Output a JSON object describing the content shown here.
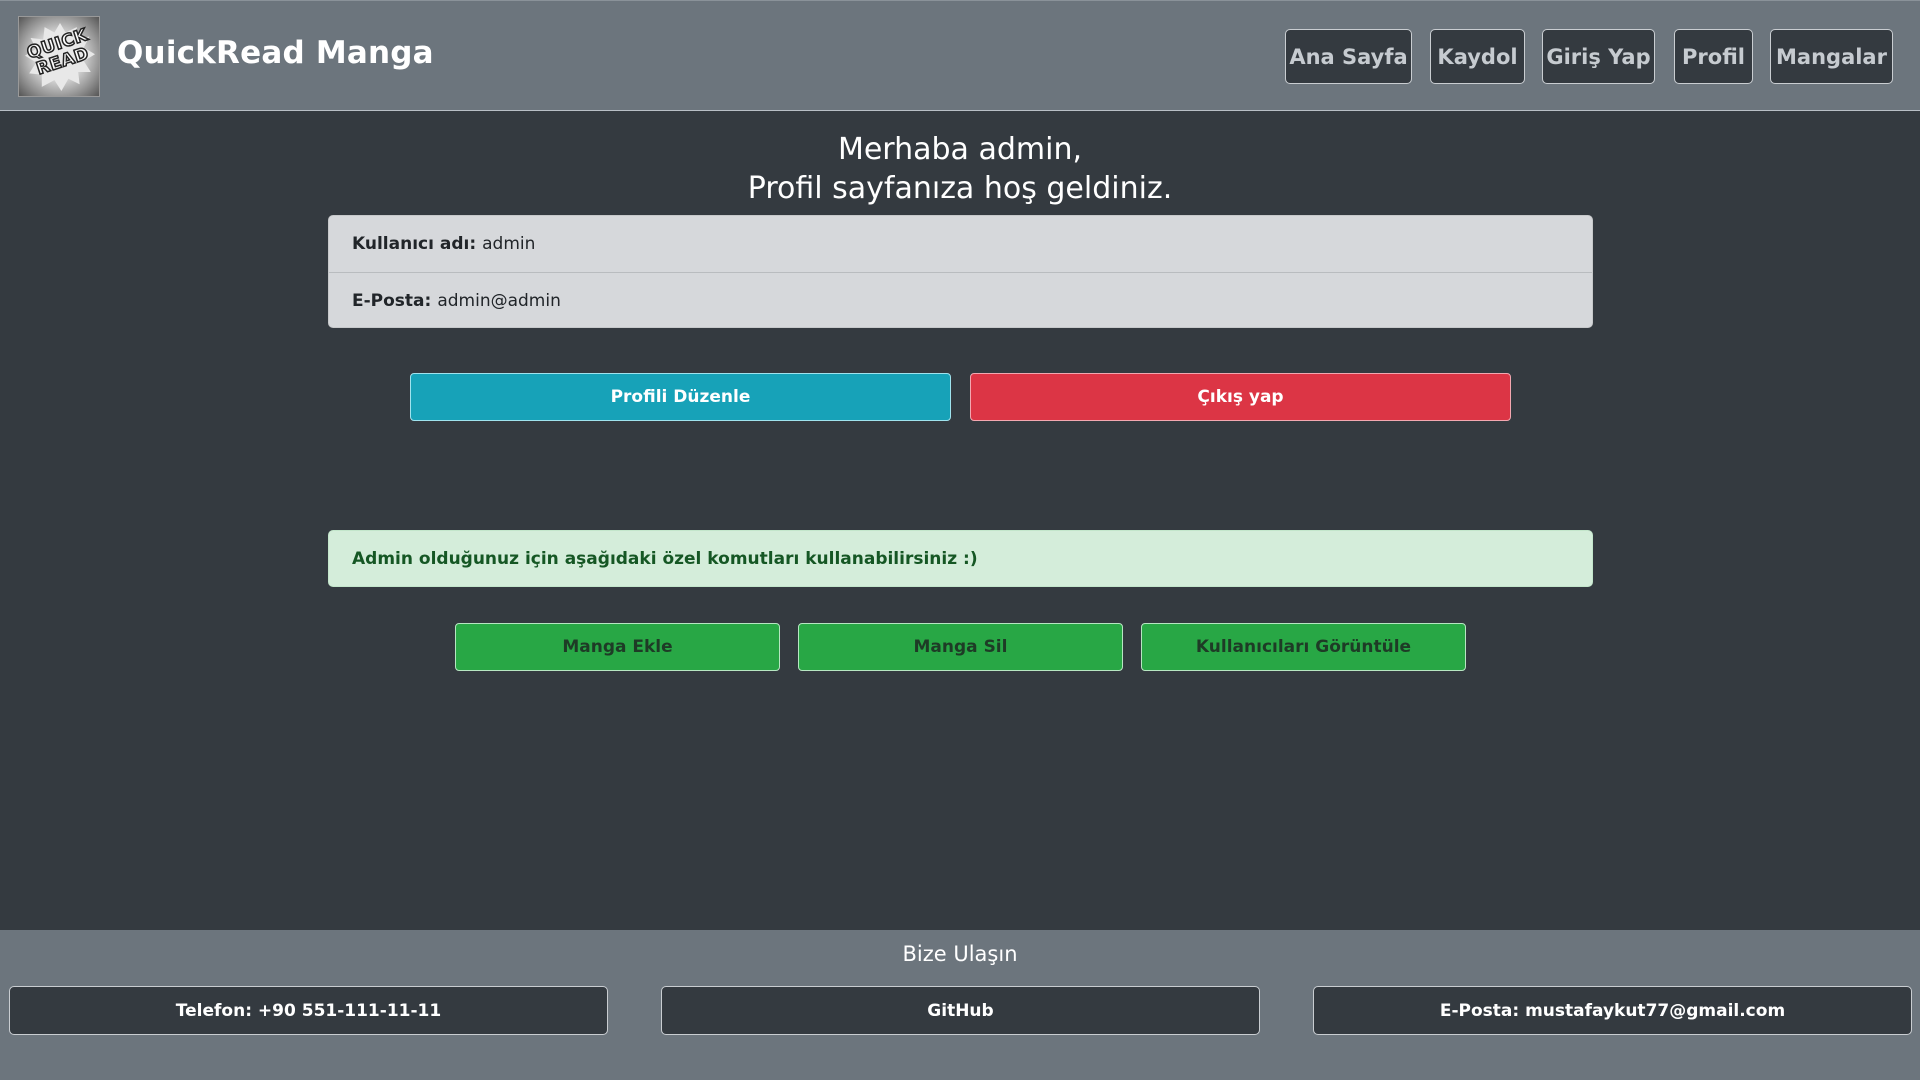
{
  "header": {
    "logo_text_line1": "QUICK",
    "logo_text_line2": "READ",
    "brand": "QuickRead Manga",
    "nav": [
      "Ana Sayfa",
      "Kaydol",
      "Giriş Yap",
      "Profil",
      "Mangalar"
    ]
  },
  "main": {
    "welcome_line1": "Merhaba admin,",
    "welcome_line2": "Profil sayfanıza hoş geldiniz.",
    "username_label": "Kullanıcı adı:",
    "username_value": "admin",
    "email_label": "E-Posta:",
    "email_value": "admin@admin",
    "edit_profile_label": "Profili Düzenle",
    "logout_label": "Çıkış yap",
    "admin_alert": "Admin olduğunuz için aşağıdaki özel komutları kullanabilirsiniz :)",
    "admin_actions": [
      "Manga Ekle",
      "Manga Sil",
      "Kullanıcıları Görüntüle"
    ]
  },
  "footer": {
    "title": "Bize Ulaşın",
    "phone": "Telefon: +90 551-111-11-11",
    "github": "GitHub",
    "email": "E-Posta: mustafaykut77@gmail.com"
  },
  "colors": {
    "header_bg": "#6c757d",
    "body_bg": "#343a40",
    "info": "#17a2b8",
    "danger": "#dc3545",
    "success": "#28a745",
    "alert_bg": "#d4edda"
  }
}
